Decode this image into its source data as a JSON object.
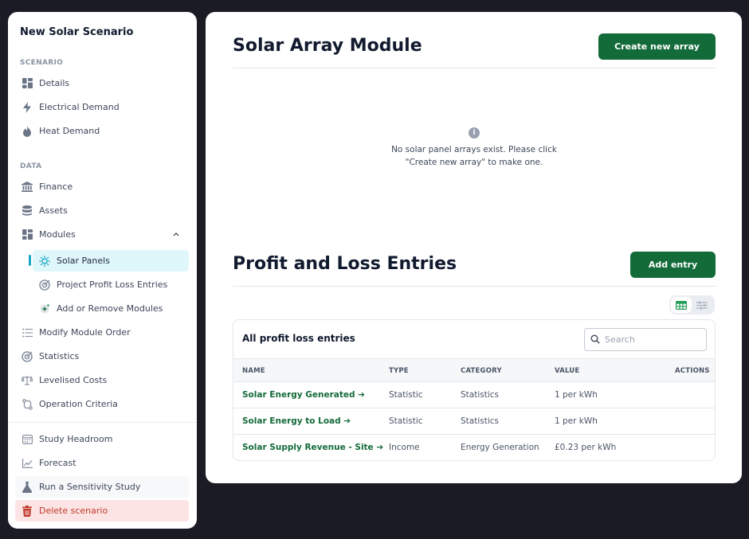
{
  "sidebar": {
    "title": "New Solar Scenario",
    "section_scenario": "SCENARIO",
    "section_data": "DATA",
    "items": {
      "details": "Details",
      "electrical_demand": "Electrical Demand",
      "heat_demand": "Heat Demand",
      "finance": "Finance",
      "assets": "Assets",
      "modules": "Modules",
      "solar_panels": "Solar Panels",
      "project_pl_entries": "Project Profit Loss Entries",
      "add_remove_modules": "Add or Remove Modules",
      "modify_module_order": "Modify Module Order",
      "statistics": "Statistics",
      "levelised_costs": "Levelised Costs",
      "operation_criteria": "Operation Criteria",
      "study_headroom": "Study Headroom",
      "forecast": "Forecast",
      "sensitivity_study": "Run a Sensitivity Study",
      "delete_scenario": "Delete scenario"
    }
  },
  "solar_array": {
    "title": "Solar Array Module",
    "create_button": "Create new array",
    "empty_line1": "No solar panel arrays exist. Please click",
    "empty_line2": "\"Create new array\" to make one."
  },
  "profit_loss": {
    "title": "Profit and Loss Entries",
    "add_button": "Add entry",
    "table_title": "All profit loss entries",
    "search_placeholder": "Search",
    "columns": {
      "name": "NAME",
      "type": "TYPE",
      "category": "CATEGORY",
      "value": "VALUE",
      "actions": "ACTIONS"
    },
    "rows": [
      {
        "name": "Solar Energy Generated ➔",
        "type": "Statistic",
        "category": "Statistics",
        "value": "1 per kWh"
      },
      {
        "name": "Solar Energy to Load ➔",
        "type": "Statistic",
        "category": "Statistics",
        "value": "1 per kWh"
      },
      {
        "name": "Solar Supply Revenue - Site ➔",
        "type": "Income",
        "category": "Energy Generation",
        "value": "£0.23 per kWh"
      }
    ]
  },
  "colors": {
    "brand_green": "#146b3a",
    "active_bg": "#dff7fb",
    "danger_bg": "#fbe4e3",
    "danger_text": "#c0392b"
  }
}
